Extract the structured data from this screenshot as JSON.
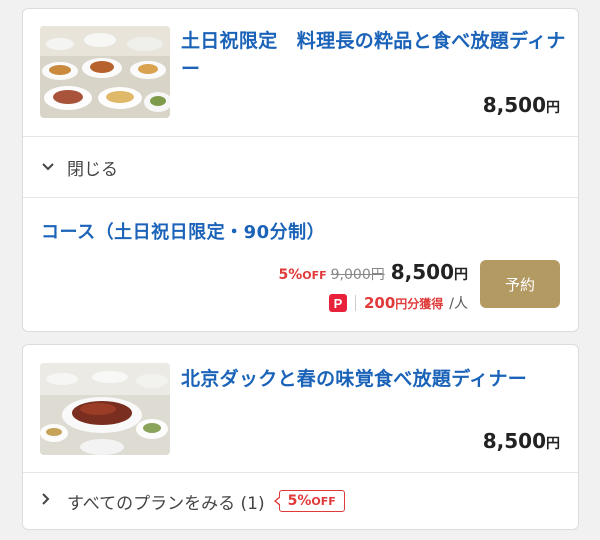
{
  "plans": [
    {
      "title": "土日祝限定　料理長の粋品と食べ放題ディナー",
      "price": "8,500",
      "currency": "円",
      "toggle_label": "閉じる",
      "course": {
        "title": "コース（土日祝日限定・90分制）",
        "discount_pct": "5%",
        "discount_off": "OFF",
        "original_price": "9,000円",
        "price": "8,500",
        "currency": "円",
        "points_icon": "P",
        "points": "200",
        "points_suffix": "円分獲得",
        "per_person": "/人",
        "reserve_label": "予約"
      }
    },
    {
      "title": "北京ダックと春の味覚食べ放題ディナー",
      "price": "8,500",
      "currency": "円",
      "toggle_label": "すべてのプランをみる (1)",
      "badge_pct": "5%",
      "badge_off": "OFF"
    }
  ],
  "colors": {
    "title_blue": "#1b63b8",
    "discount_red": "#e03a3a",
    "reserve_gold": "#b39a63",
    "points_icon_red": "#e8223b"
  }
}
